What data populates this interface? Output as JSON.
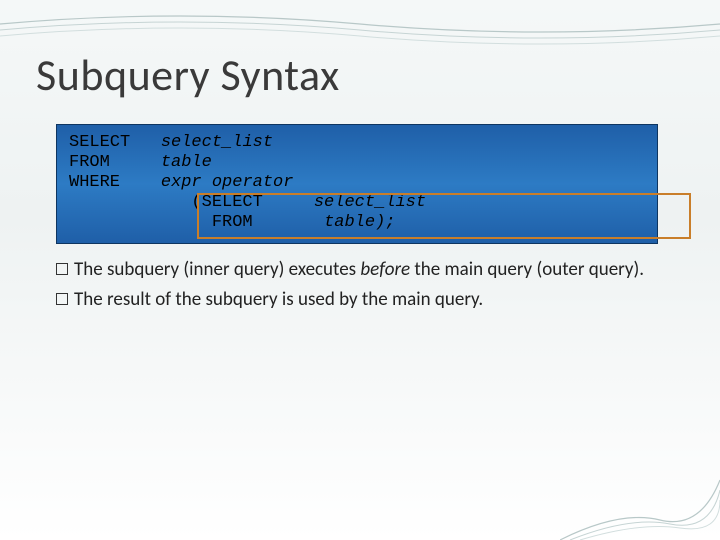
{
  "title": "Subquery Syntax",
  "code": {
    "kw_select": "SELECT",
    "kw_from": "FROM",
    "kw_where": "WHERE",
    "outer_select_list": "select_list",
    "outer_table": "table",
    "outer_expr": "expr operator",
    "sub_open": "(SELECT",
    "sub_from": " FROM",
    "sub_select_list": "select_list",
    "sub_table_close": "table);"
  },
  "bullets": [
    {
      "pre": "The subquery (inner query) executes ",
      "em": "before",
      "post": " the main query (outer query)."
    },
    {
      "pre": "The result of the subquery is used by the main query.",
      "em": "",
      "post": ""
    }
  ]
}
